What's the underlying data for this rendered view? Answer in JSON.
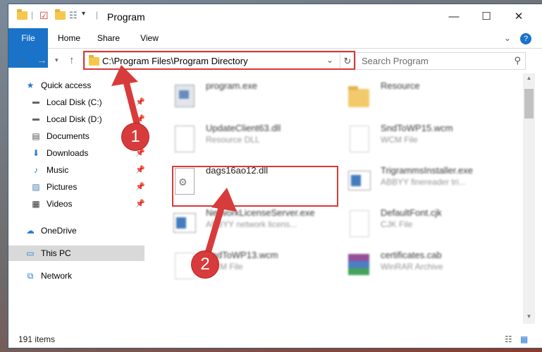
{
  "window": {
    "title": "Program",
    "minimize": "—",
    "maximize": "☐",
    "close": "✕"
  },
  "ribbon": {
    "tabs": [
      "File",
      "Home",
      "Share",
      "View"
    ],
    "expand": "⌄",
    "help": "?"
  },
  "address": {
    "path": "C:\\Program Files\\Program Directory",
    "search_placeholder": "Search Program"
  },
  "nav": {
    "items": [
      {
        "label": "Quick access",
        "icon": "star-icon"
      },
      {
        "label": "Local Disk (C:)",
        "icon": "drive-icon"
      },
      {
        "label": "Local Disk (D:)",
        "icon": "drive-icon"
      },
      {
        "label": "Documents",
        "icon": "document-icon"
      },
      {
        "label": "Downloads",
        "icon": "download-icon"
      },
      {
        "label": "Music",
        "icon": "music-icon"
      },
      {
        "label": "Pictures",
        "icon": "picture-icon"
      },
      {
        "label": "Videos",
        "icon": "video-icon"
      },
      {
        "label": "OneDrive",
        "icon": "cloud-icon"
      },
      {
        "label": "This PC",
        "icon": "computer-icon"
      },
      {
        "label": "Network",
        "icon": "network-icon"
      }
    ]
  },
  "files": [
    {
      "name": "program.exe",
      "desc": ""
    },
    {
      "name": "Resource",
      "desc": ""
    },
    {
      "name": "UpdateClient63.dll",
      "desc": "Resource DLL"
    },
    {
      "name": "SndToWP15.wcm",
      "desc": "WCM File"
    },
    {
      "name": "dags16ao12.dll",
      "desc": ""
    },
    {
      "name": "TrigrammsInstaller.exe",
      "desc": "ABBYY finereader tri..."
    },
    {
      "name": "NetworkLicenseServer.exe",
      "desc": "ABBYY network licens..."
    },
    {
      "name": "DefaultFont.cjk",
      "desc": "CJK File"
    },
    {
      "name": "SndToWP13.wcm",
      "desc": "WCM File"
    },
    {
      "name": "certificates.cab",
      "desc": "WinRAR Archive"
    }
  ],
  "status": {
    "count": "191 items"
  },
  "markers": [
    "1",
    "2"
  ],
  "colors": {
    "accent": "#1a73c8",
    "highlight": "#d93a3a"
  }
}
